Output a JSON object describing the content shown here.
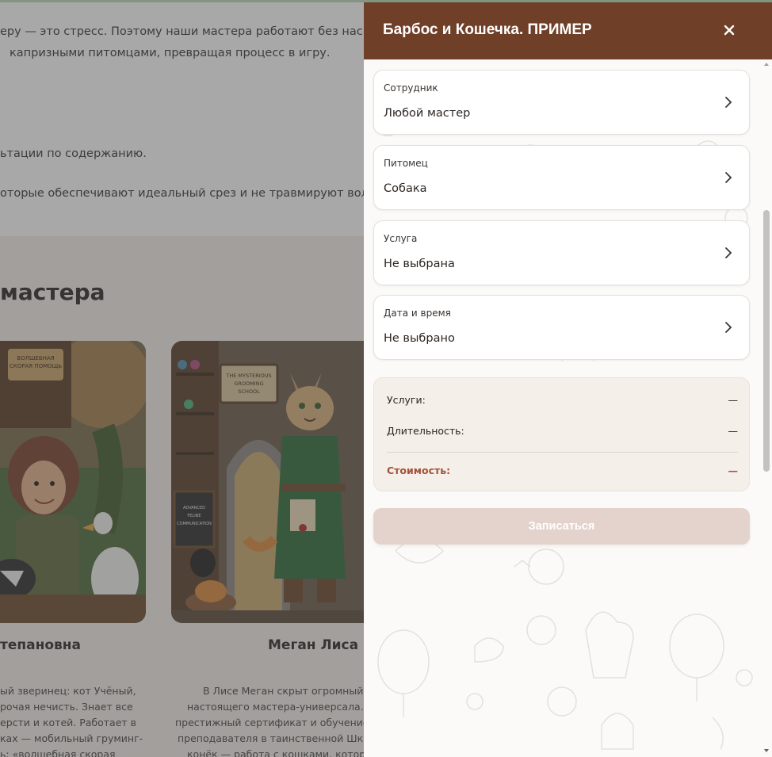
{
  "background": {
    "paragraph_lines": [
      "еру — это стресс. Поэтому наши мастера работают без насили",
      "капризными питомцами, превращая процесс в игру.",
      "ьтации по содержанию.",
      "оторые обеспечивают идеальный срез и не травмируют волос"
    ],
    "section_heading": "мастера",
    "cards": [
      {
        "name": "тепановна",
        "desc_lines": [
          "ый зверинец: кот Учёный,",
          "рочая нечисть. Знает все",
          "ерсти и котей. Работает в",
          "ках — мобильный груминг-",
          "ь: «волшебная скорая"
        ],
        "sign_text": "ВОЛШЕБНАЯ СКОРАЯ ПОМОЩЬ ГРУМИНГА"
      },
      {
        "name": "Меган Лиса",
        "desc_lines": [
          "В Лисе Меган скрыт огромный",
          "настоящего мастера-универсала.",
          "престижный сертификат и обучение",
          "преподавателя в таинственной Шко",
          "конёк — работа с кошками, котор"
        ],
        "sign_text": "THE MYSTERIOUS GROOMING SCHOOL",
        "board_text": "ADVANCED FELINE COMMUNICATION"
      }
    ]
  },
  "drawer": {
    "title": "Барбос и Кошечка. ПРИМЕР",
    "fields": [
      {
        "label": "Сотрудник",
        "value": "Любой мастер"
      },
      {
        "label": "Питомец",
        "value": "Собака"
      },
      {
        "label": "Услуга",
        "value": "Не выбрана"
      },
      {
        "label": "Дата и время",
        "value": "Не выбрано"
      }
    ],
    "summary": {
      "services_label": "Услуги:",
      "services_value": "—",
      "duration_label": "Длительность:",
      "duration_value": "—",
      "cost_label": "Стоимость:",
      "cost_value": "—"
    },
    "submit_label": "Записаться"
  },
  "colors": {
    "header": "#6f3f28",
    "accent_cost": "#a4513a",
    "submit_disabled": "#e3d3cc",
    "summary_bg": "#f5efea"
  },
  "icons": [
    "close-icon",
    "chevron-right-icon"
  ]
}
